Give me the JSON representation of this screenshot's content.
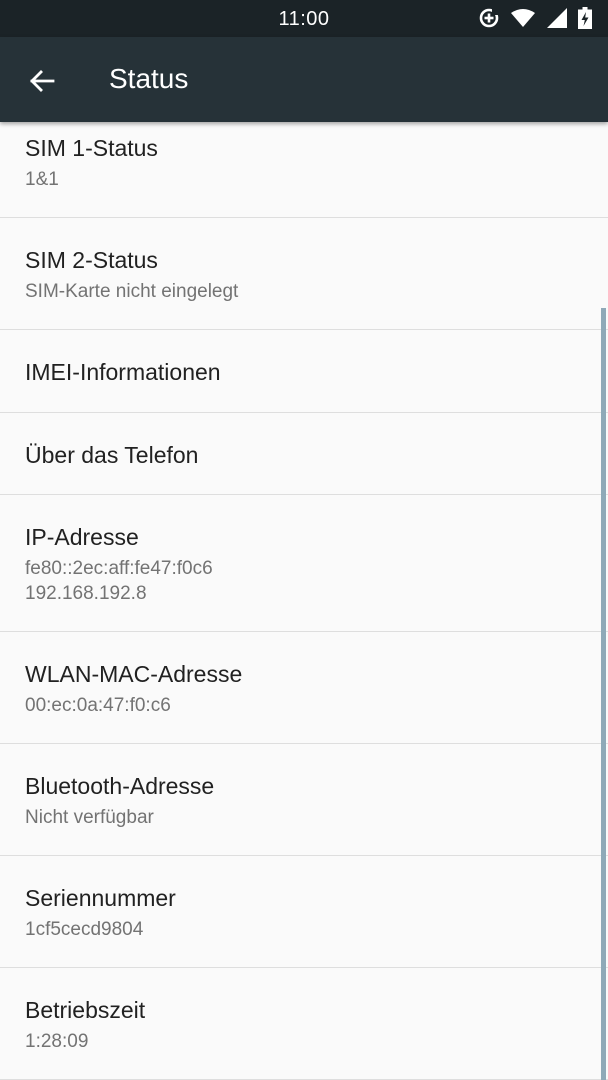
{
  "status_bar": {
    "time": "11:00",
    "icons": [
      "data-saver-icon",
      "wifi-icon",
      "signal-icon",
      "battery-charging-icon"
    ]
  },
  "toolbar": {
    "back_icon": "arrow-back-icon",
    "title": "Status"
  },
  "items": [
    {
      "label": "SIM 1-Status",
      "sub": "1&1"
    },
    {
      "label": "SIM 2-Status",
      "sub": "SIM-Karte nicht eingelegt"
    },
    {
      "label": "IMEI-Informationen",
      "sub": ""
    },
    {
      "label": "Über das Telefon",
      "sub": ""
    },
    {
      "label": "IP-Adresse",
      "sub": "fe80::2ec:aff:fe47:f0c6",
      "sub2": "192.168.192.8"
    },
    {
      "label": "WLAN-MAC-Adresse",
      "sub": "00:ec:0a:47:f0:c6"
    },
    {
      "label": "Bluetooth-Adresse",
      "sub": "Nicht verfügbar"
    },
    {
      "label": "Seriennummer",
      "sub": "1cf5cecd9804"
    },
    {
      "label": "Betriebszeit",
      "sub": "1:28:09"
    }
  ],
  "colors": {
    "status_bar": "#1b2327",
    "toolbar": "#263238",
    "background": "#fafafa",
    "scrollbar": "#8fa9b8"
  }
}
